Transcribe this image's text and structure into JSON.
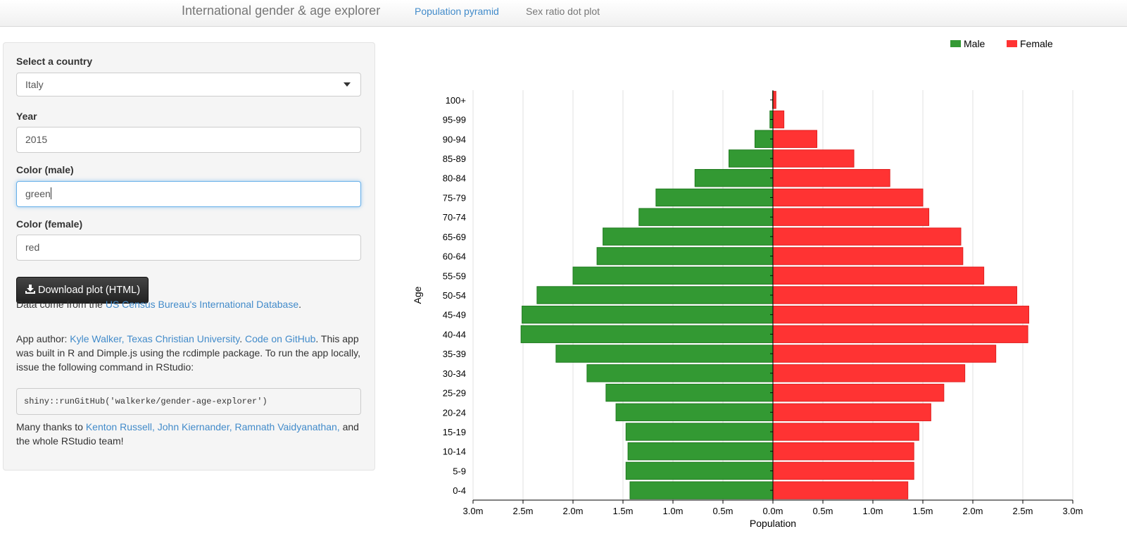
{
  "navbar": {
    "title": "International gender & age explorer",
    "tabs": [
      {
        "label": "Population pyramid",
        "active": true
      },
      {
        "label": "Sex ratio dot plot",
        "active": false
      }
    ]
  },
  "sidebar": {
    "country_label": "Select a country",
    "country_value": "Italy",
    "year_label": "Year",
    "year_value": "2015",
    "male_color_label": "Color (male)",
    "male_color_value": "green",
    "female_color_label": "Color (female)",
    "female_color_value": "red",
    "download_label": "Download plot (HTML)",
    "data_source": {
      "prefix": "Data come from the ",
      "link": "US Census Bureau's International Database",
      "suffix": "."
    },
    "author": {
      "prefix": "App author: ",
      "link1": "Kyle Walker, Texas Christian University",
      "sep": ". ",
      "link2": "Code on GitHub",
      "suffix": ". This app was built in R and Dimple.js using the rcdimple package. To run the app locally, issue the following command in RStudio:"
    },
    "code": "shiny::runGitHub('walkerke/gender-age-explorer')",
    "thanks": {
      "prefix": "Many thanks to ",
      "link": "Kenton Russell, John Kiernander, Ramnath Vaidyanathan,",
      "suffix": " and the whole RStudio team!"
    }
  },
  "colors": {
    "male": "#339933",
    "female": "#ff3333",
    "link": "#428bca",
    "grid": "#e0e0e0"
  },
  "chart_data": {
    "type": "bar",
    "orientation": "horizontal",
    "xlabel": "Population",
    "ylabel": "Age",
    "xlim": [
      -3000000,
      3000000
    ],
    "x_ticks": [
      -3000000,
      -2500000,
      -2000000,
      -1500000,
      -1000000,
      -500000,
      0,
      500000,
      1000000,
      1500000,
      2000000,
      2500000,
      3000000
    ],
    "x_tick_labels": [
      "3.0m",
      "2.5m",
      "2.0m",
      "1.5m",
      "1.0m",
      "0.5m",
      "0.0m",
      "0.5m",
      "1.0m",
      "1.5m",
      "2.0m",
      "2.5m",
      "3.0m"
    ],
    "grid": true,
    "legend_position": "top-right",
    "categories": [
      "100+",
      "95-99",
      "90-94",
      "85-89",
      "80-84",
      "75-79",
      "70-74",
      "65-69",
      "60-64",
      "55-59",
      "50-54",
      "45-49",
      "40-44",
      "35-39",
      "30-34",
      "25-29",
      "20-24",
      "15-19",
      "10-14",
      "5-9",
      "0-4"
    ],
    "series": [
      {
        "name": "Male",
        "values": [
          3000,
          30000,
          180000,
          440000,
          780000,
          1170000,
          1340000,
          1700000,
          1760000,
          2000000,
          2360000,
          2510000,
          2520000,
          2170000,
          1860000,
          1670000,
          1570000,
          1470000,
          1450000,
          1470000,
          1430000
        ]
      },
      {
        "name": "Female",
        "values": [
          30000,
          110000,
          440000,
          810000,
          1170000,
          1500000,
          1560000,
          1880000,
          1900000,
          2110000,
          2440000,
          2560000,
          2550000,
          2230000,
          1920000,
          1710000,
          1580000,
          1460000,
          1410000,
          1410000,
          1350000
        ]
      }
    ]
  }
}
